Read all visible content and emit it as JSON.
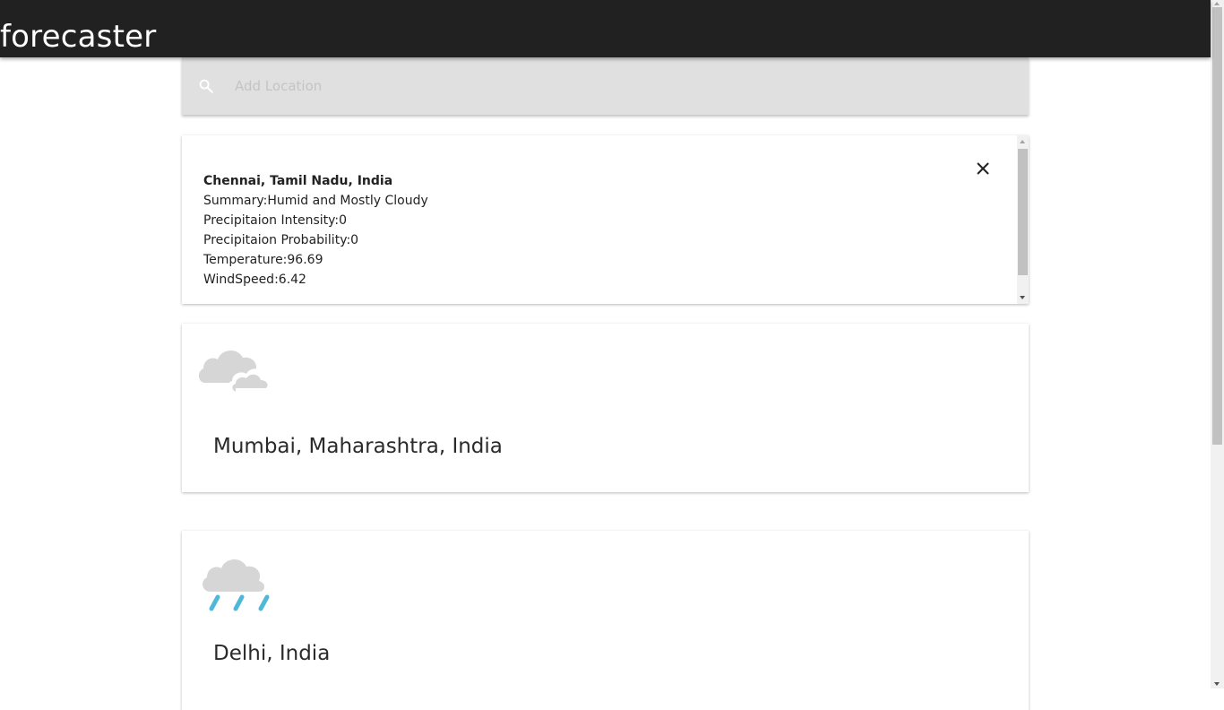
{
  "app": {
    "title": "forecaster"
  },
  "search": {
    "placeholder": "Add Location",
    "value": ""
  },
  "detail": {
    "location": "Chennai, Tamil Nadu, India",
    "lines": [
      "Summary:Humid and Mostly Cloudy",
      "Precipitaion Intensity:0",
      "Precipitaion Probability:0",
      "Temperature:96.69",
      "WindSpeed:6.42"
    ]
  },
  "cities": [
    {
      "name": "Mumbai, Maharashtra, India",
      "icon": "cloudy-icon"
    },
    {
      "name": "Delhi, India",
      "icon": "rain-icon"
    }
  ],
  "colors": {
    "app_bar": "#212121",
    "search_bg": "#e0e0e0",
    "cloud": "#d6d6d6",
    "rain": "#4fb8d8"
  }
}
